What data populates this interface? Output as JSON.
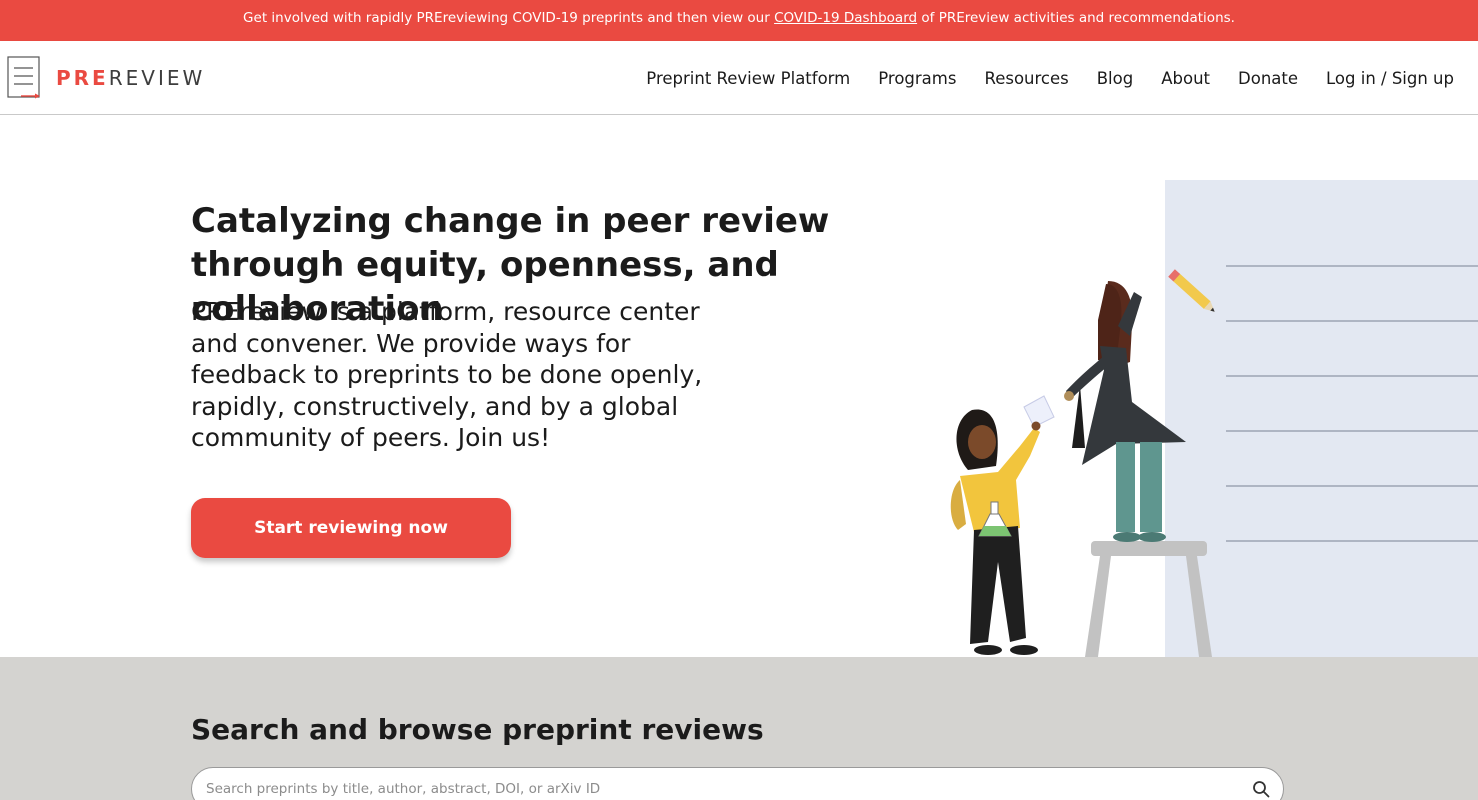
{
  "banner": {
    "text_before": "Get involved with rapidly PREreviewing COVID-19 preprints and then view our ",
    "link_text": "COVID-19 Dashboard",
    "text_after": " of PREreview activities and recommendations."
  },
  "header": {
    "logo_pre": "PRE",
    "logo_review": "REVIEW",
    "nav": [
      {
        "label": "Preprint Review Platform"
      },
      {
        "label": "Programs"
      },
      {
        "label": "Resources"
      },
      {
        "label": "Blog"
      },
      {
        "label": "About"
      },
      {
        "label": "Donate"
      },
      {
        "label": "Log in / Sign up"
      }
    ]
  },
  "hero": {
    "title": "Catalyzing change in peer review through equity, openness, and collaboration",
    "description": "PREreview is a platform, resource center and convener. We provide ways for feedback to preprints to be done openly, rapidly, constructively, and by a global community of peers. Join us!",
    "cta_label": "Start reviewing now"
  },
  "search": {
    "heading": "Search and browse preprint reviews",
    "placeholder": "Search preprints by title, author, abstract, DOI, or arXiv ID",
    "value": ""
  },
  "colors": {
    "brand_red": "#ea4a41",
    "search_band": "#d4d3d0",
    "whiteboard": "#e3e8f2"
  },
  "icons": [
    "logo-mark-icon",
    "search-icon"
  ]
}
